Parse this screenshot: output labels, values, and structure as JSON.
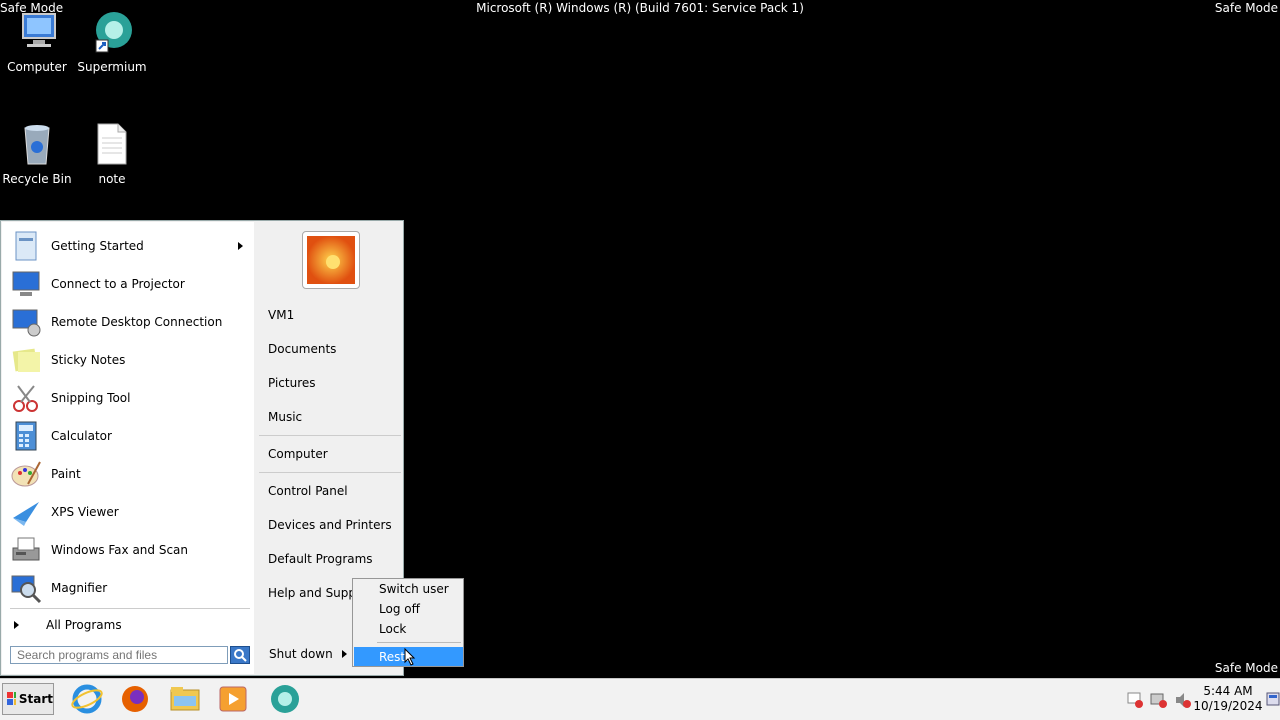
{
  "overlay": {
    "safe_mode": "Safe Mode",
    "build": "Microsoft (R) Windows (R) (Build 7601: Service Pack 1)"
  },
  "desktop": {
    "icons": [
      {
        "label": "Computer",
        "icon": "computer-icon"
      },
      {
        "label": "Supermium",
        "icon": "supermium-icon"
      },
      {
        "label": "Recycle Bin",
        "icon": "recycle-bin-icon"
      },
      {
        "label": "note",
        "icon": "text-file-icon"
      }
    ]
  },
  "start_menu": {
    "programs": [
      {
        "label": "Getting Started",
        "icon": "getting-started-icon"
      },
      {
        "label": "Connect to a Projector",
        "icon": "projector-icon"
      },
      {
        "label": "Remote Desktop Connection",
        "icon": "remote-desktop-icon"
      },
      {
        "label": "Sticky Notes",
        "icon": "sticky-notes-icon"
      },
      {
        "label": "Snipping Tool",
        "icon": "scissors-icon"
      },
      {
        "label": "Calculator",
        "icon": "calculator-icon"
      },
      {
        "label": "Paint",
        "icon": "paint-icon"
      },
      {
        "label": "XPS Viewer",
        "icon": "xps-viewer-icon"
      },
      {
        "label": "Windows Fax and Scan",
        "icon": "fax-icon"
      },
      {
        "label": "Magnifier",
        "icon": "magnifier-icon"
      }
    ],
    "all_programs": "All Programs",
    "search_placeholder": "Search programs and files",
    "right_items": {
      "user": "VM1",
      "documents": "Documents",
      "pictures": "Pictures",
      "music": "Music",
      "computer": "Computer",
      "control_panel": "Control Panel",
      "devices": "Devices and Printers",
      "default_programs": "Default Programs",
      "help": "Help and Suppo"
    },
    "shutdown": "Shut down"
  },
  "context_menu": {
    "items": [
      "Switch user",
      "Log off",
      "Lock",
      "Resta"
    ]
  },
  "taskbar": {
    "start": "Start",
    "apps": [
      "internet-explorer-icon",
      "firefox-icon",
      "explorer-icon",
      "media-player-icon",
      "supermium-icon"
    ],
    "time": "5:44 AM",
    "date": "10/19/2024"
  }
}
